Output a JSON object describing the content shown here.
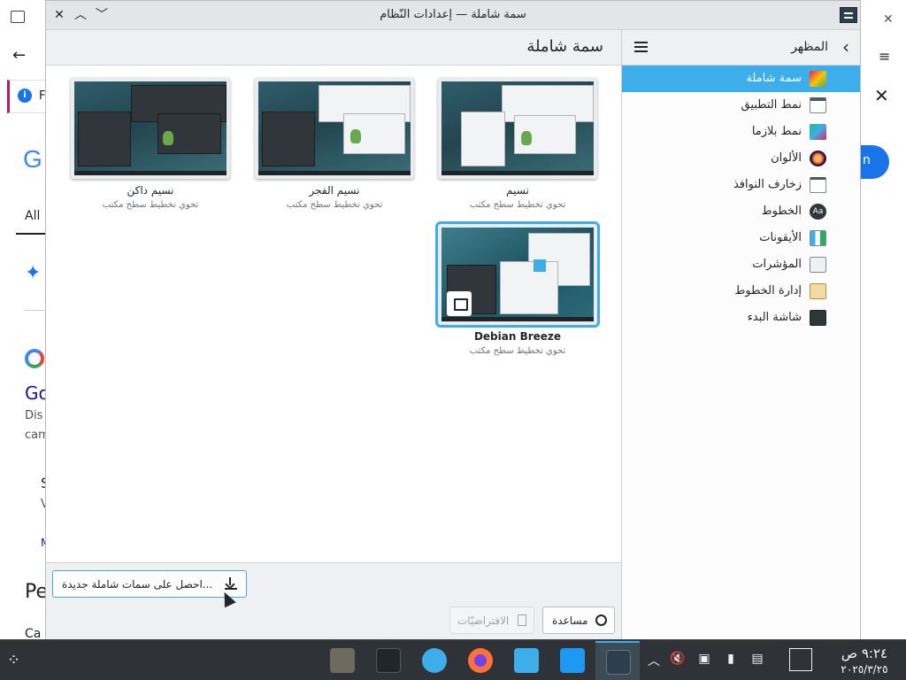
{
  "background": {
    "info_letter": "F",
    "g_letter": "G",
    "all_tab": "All",
    "link_text": "Go",
    "dis_text": "Dis",
    "cam_text": "cam",
    "s_text": "S",
    "v_text": "V",
    "m_text": "M",
    "pe_text": "Pe",
    "ca_text": "Ca",
    "btn_text": "n"
  },
  "window": {
    "title": "سمة شاملة — إعدادات النّظام"
  },
  "content": {
    "title": "سمة شاملة",
    "themes": [
      {
        "name": "نسيم",
        "desc": "تحوي تخطيط سطح مكتب",
        "variant": "light",
        "selected": false
      },
      {
        "name": "نسيم الفجر",
        "desc": "تحوي تخطيط سطح مكتب",
        "variant": "mixed",
        "selected": false
      },
      {
        "name": "نسيم داكن",
        "desc": "تحوي تخطيط سطح مكتب",
        "variant": "dark",
        "selected": false
      },
      {
        "name": "Debian Breeze",
        "desc": "تحوي تخطيط سطح مكتب",
        "variant": "debian",
        "selected": true
      }
    ],
    "get_new_label": "احصل على سمات شاملة جديدة...",
    "defaults_label": "الافتراضيّات",
    "help_label": "مساعدة"
  },
  "sidebar": {
    "title": "المظهر",
    "items": [
      {
        "label": "سمة شاملة",
        "icon": "global-theme-icon",
        "active": true
      },
      {
        "label": "نمط التطبيق",
        "icon": "application-style-icon",
        "active": false
      },
      {
        "label": "نمط بلازما",
        "icon": "plasma-style-icon",
        "active": false
      },
      {
        "label": "الألوان",
        "icon": "colors-icon",
        "active": false
      },
      {
        "label": "زخارف النوافذ",
        "icon": "window-decorations-icon",
        "active": false
      },
      {
        "label": "الخطوط",
        "icon": "fonts-icon",
        "active": false
      },
      {
        "label": "الأيقونات",
        "icon": "icons-icon",
        "active": false
      },
      {
        "label": "المؤشرات",
        "icon": "cursors-icon",
        "active": false
      },
      {
        "label": "إدارة الخطوط",
        "icon": "font-management-icon",
        "active": false
      },
      {
        "label": "شاشة البدء",
        "icon": "splash-screen-icon",
        "active": false
      }
    ]
  },
  "taskbar": {
    "time": "٩:٢٤ ص",
    "date": "٢٠٢٥/٣/٢٥"
  },
  "colors": {
    "accent": "#3daee9",
    "taskbar": "#2f3337"
  }
}
